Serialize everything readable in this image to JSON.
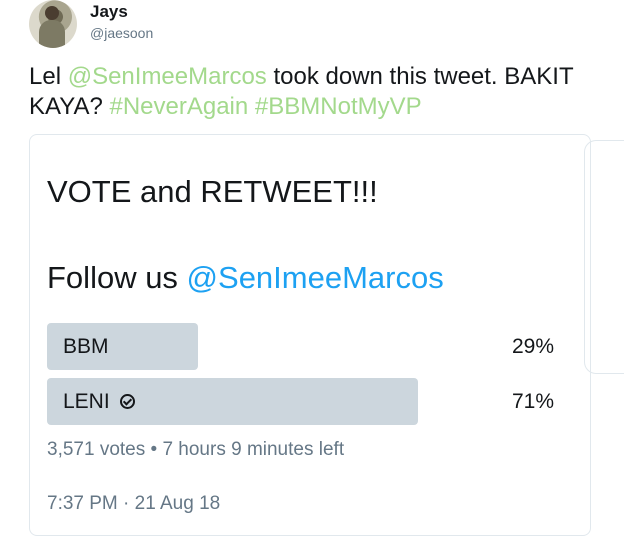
{
  "user": {
    "name": "Jays",
    "handle": "@jaesoon"
  },
  "tweet": {
    "prefix": "Lel ",
    "mention": "@SenImeeMarcos",
    "middle": " took down this tweet. BAKIT KAYA? ",
    "hashtag1": "#NeverAgain",
    "space": " ",
    "hashtag2": "#BBMNotMyVP"
  },
  "poll": {
    "line1": "VOTE and RETWEET!!!",
    "line2_prefix": "Follow us ",
    "line2_mention": "@SenImeeMarcos",
    "options": [
      {
        "label": "BBM",
        "percent_text": "29%",
        "percent": 29,
        "winner": false
      },
      {
        "label": "LENI",
        "percent_text": "71%",
        "percent": 71,
        "winner": true
      }
    ],
    "meta": "3,571 votes • 7 hours 9 minutes left"
  },
  "timestamp": "7:37 PM · 21 Aug 18",
  "colors": {
    "link": "#1da1f2",
    "hashtag_faded": "#a3d98c",
    "bar": "#ccd6dd",
    "muted": "#657786"
  },
  "icons": {
    "winner": "check-circle-icon"
  }
}
